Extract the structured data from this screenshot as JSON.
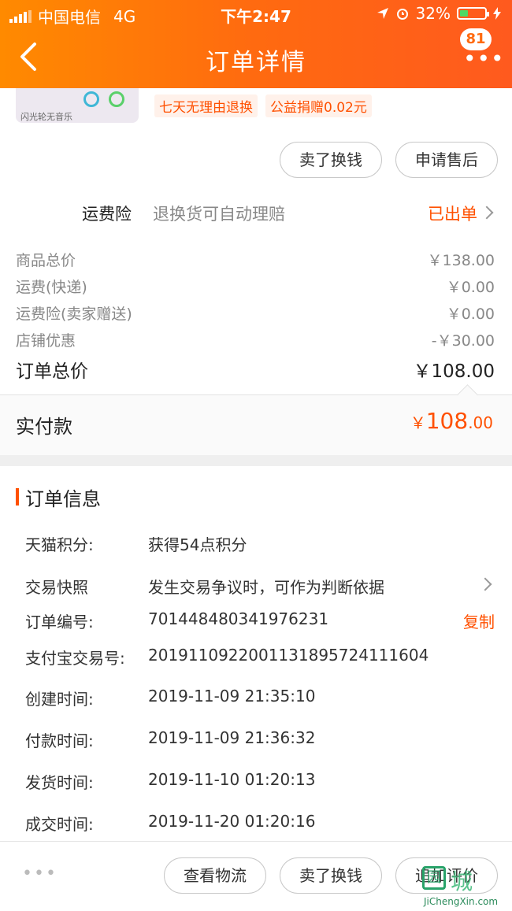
{
  "status_bar": {
    "carrier": "中国电信",
    "network": "4G",
    "time": "下午2:47",
    "battery": "32%"
  },
  "nav": {
    "title": "订单详情",
    "badge": "81",
    "more_label": "•••"
  },
  "product": {
    "thumb_caption": "闪光轮无音乐",
    "tags": [
      "七天无理由退换",
      "公益捐赠0.02元"
    ]
  },
  "actions_top": {
    "sell_label": "卖了换钱",
    "after_sale_label": "申请售后"
  },
  "insurance": {
    "label": "运费险",
    "description": "退换货可自动理赔",
    "status": "已出单"
  },
  "prices": [
    {
      "label": "商品总价",
      "value": "￥138.00"
    },
    {
      "label": "运费(快递)",
      "value": "￥0.00"
    },
    {
      "label": "运费险(卖家赠送)",
      "value": "￥0.00"
    },
    {
      "label": "店铺优惠",
      "value": "-￥30.00"
    }
  ],
  "total": {
    "label": "订单总价",
    "value": "￥108.00"
  },
  "paid": {
    "label": "实付款",
    "currency": "￥",
    "integer": "108",
    "decimal": ".00"
  },
  "order_info": {
    "title": "订单信息",
    "rows": [
      {
        "label": "天猫积分:",
        "value": "获得54点积分"
      },
      {
        "label": "交易快照",
        "value": "发生交易争议时，可作为判断依据"
      },
      {
        "label": "订单编号:",
        "value": "701448480341976231"
      },
      {
        "label": "支付宝交易号:",
        "value": "2019110922001131895724111604"
      },
      {
        "label": "创建时间:",
        "value": "2019-11-09 21:35:10"
      },
      {
        "label": "付款时间:",
        "value": "2019-11-09 21:36:32"
      },
      {
        "label": "发货时间:",
        "value": "2019-11-10 01:20:13"
      },
      {
        "label": "成交时间:",
        "value": "2019-11-20 01:20:16"
      }
    ],
    "copy_label": "复制"
  },
  "bottom_bar": {
    "more_dots": "•••",
    "logistics_label": "查看物流",
    "sell_label": "卖了换钱",
    "review_label": "追加评价"
  },
  "watermark": {
    "mark": "园",
    "text": "城",
    "url": "JiChengXin.com"
  },
  "colors": {
    "accent": "#ff5000",
    "header_start": "#ff8a00",
    "header_end": "#ff5a1e"
  }
}
